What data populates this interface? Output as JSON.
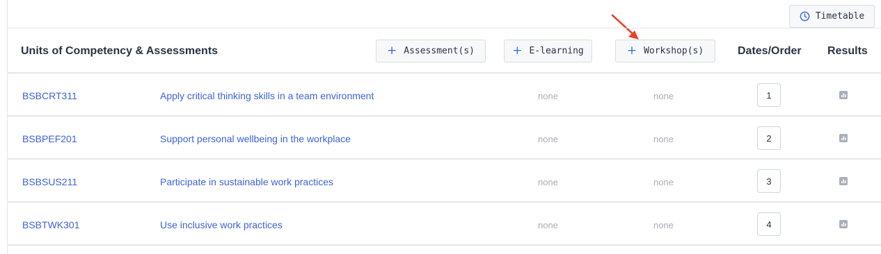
{
  "toolbar": {
    "timetable_label": "Timetable",
    "timetable_icon": "clock-icon"
  },
  "header": {
    "title": "Units of Competency & Assessments",
    "add_assessment_label": "Assessment(s)",
    "add_elearning_label": "E-learning",
    "add_workshop_label": "Workshop(s)",
    "dates_order_label": "Dates/Order",
    "results_label": "Results",
    "plus_symbol": "+"
  },
  "units": [
    {
      "code": "BSBCRT311",
      "title": "Apply critical thinking skills in a team environment",
      "elearning": "none",
      "workshop": "none",
      "order": "1"
    },
    {
      "code": "BSBPEF201",
      "title": "Support personal wellbeing in the workplace",
      "elearning": "none",
      "workshop": "none",
      "order": "2"
    },
    {
      "code": "BSBSUS211",
      "title": "Participate in sustainable work practices",
      "elearning": "none",
      "workshop": "none",
      "order": "3"
    },
    {
      "code": "BSBTWK301",
      "title": "Use inclusive work practices",
      "elearning": "none",
      "workshop": "none",
      "order": "4"
    }
  ],
  "colors": {
    "link": "#3d63d6",
    "accent": "#3d6fd8",
    "annotation_arrow": "#e5432b",
    "muted": "#a7adb5"
  },
  "icons": {
    "results": "bar-chart-icon",
    "annotation": "red-arrow-annotation"
  }
}
